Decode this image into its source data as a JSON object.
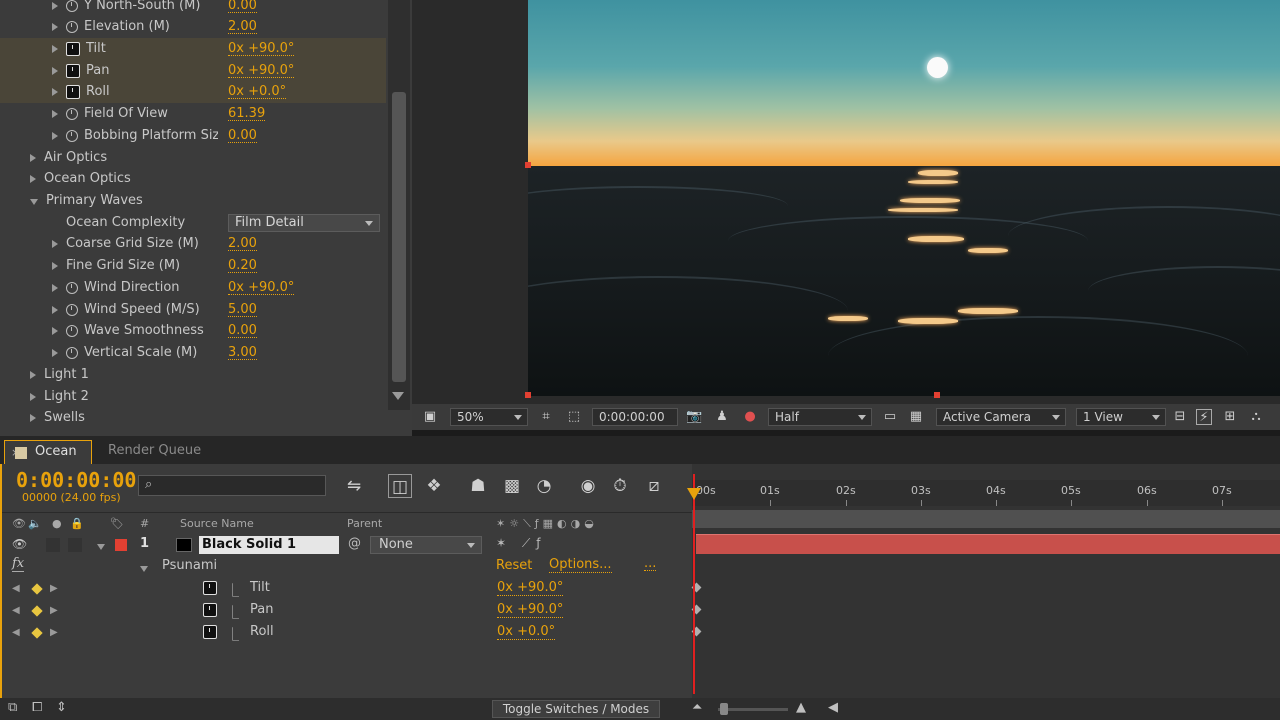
{
  "effects": {
    "rows": [
      {
        "label": "Y North-South (M)",
        "value": "0.00"
      },
      {
        "label": "Elevation (M)",
        "value": "2.00"
      },
      {
        "label": "Tilt",
        "value": "0x +90.0°"
      },
      {
        "label": "Pan",
        "value": "0x +90.0°"
      },
      {
        "label": "Roll",
        "value": "0x +0.0°"
      },
      {
        "label": "Field Of View",
        "value": "61.39"
      },
      {
        "label": "Bobbing Platform Size",
        "value": "0.00"
      },
      {
        "label": "Air Optics"
      },
      {
        "label": "Ocean Optics"
      },
      {
        "label": "Primary Waves"
      },
      {
        "label": "Ocean Complexity",
        "value": "Film Detail"
      },
      {
        "label": "Coarse Grid Size (M)",
        "value": "2.00"
      },
      {
        "label": "Fine Grid Size (M)",
        "value": "0.20"
      },
      {
        "label": "Wind Direction",
        "value": "0x +90.0°"
      },
      {
        "label": "Wind Speed (M/S)",
        "value": "5.00"
      },
      {
        "label": "Wave Smoothness",
        "value": "0.00"
      },
      {
        "label": "Vertical Scale (M)",
        "value": "3.00"
      },
      {
        "label": "Light 1"
      },
      {
        "label": "Light 2"
      },
      {
        "label": "Swells"
      }
    ]
  },
  "viewer_toolbar": {
    "zoom": "50%",
    "timecode": "0:00:00:00",
    "resolution": "Half",
    "camera": "Active Camera",
    "views": "1 View"
  },
  "tabs": {
    "active": "Ocean",
    "inactive": "Render Queue"
  },
  "timeline": {
    "timecode": "0:00:00:00",
    "fps": "00000 (24.00 fps)",
    "headers": {
      "num": "#",
      "source_name": "Source Name",
      "parent": "Parent"
    },
    "layer": {
      "number": "1",
      "name": "Black Solid 1",
      "parent": "None"
    },
    "effect": {
      "fx_label": "fx",
      "name": "Psunami",
      "reset": "Reset",
      "options": "Options...",
      "more": "..."
    },
    "properties": [
      {
        "name": "Tilt",
        "value": "0x +90.0°"
      },
      {
        "name": "Pan",
        "value": "0x +90.0°"
      },
      {
        "name": "Roll",
        "value": "0x +0.0°"
      }
    ],
    "ruler": [
      "00s",
      "01s",
      "02s",
      "03s",
      "04s",
      "05s",
      "06s",
      "07s"
    ],
    "toggle_label": "Toggle Switches / Modes"
  },
  "colors": {
    "accent": "#e8a20c",
    "layer_bar": "#c8504b",
    "label_red": "#e24032"
  }
}
